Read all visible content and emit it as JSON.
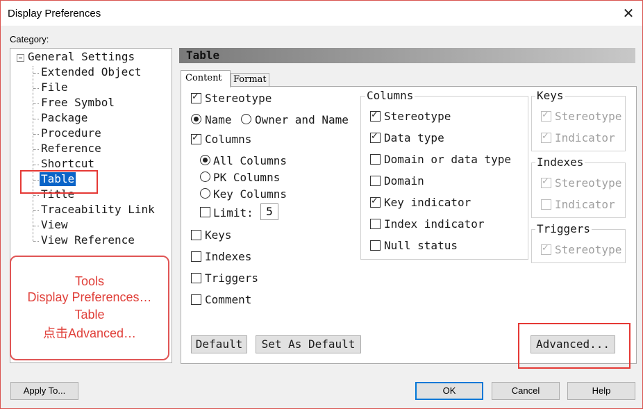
{
  "window": {
    "title": "Display Preferences",
    "close_glyph": "✕"
  },
  "category": {
    "label": "Category:"
  },
  "tree": {
    "root": "General Settings",
    "items": [
      "Extended Object",
      "File",
      "Free Symbol",
      "Package",
      "Procedure",
      "Reference",
      "Shortcut",
      "Table",
      "Title",
      "Traceability Link",
      "View",
      "View Reference"
    ],
    "selected": "Table"
  },
  "annotation": {
    "lines": [
      "Tools",
      "Display Preferences…",
      "Table",
      "点击Advanced…"
    ]
  },
  "panel": {
    "header": "Table",
    "tabs": [
      "Content",
      "Format"
    ],
    "active_tab": "Content"
  },
  "left_options": {
    "stereotype": {
      "label": "Stereotype",
      "checked": true
    },
    "name_radio": {
      "label": "Name",
      "checked": true
    },
    "owner_radio": {
      "label": "Owner and Name",
      "checked": false
    },
    "columns": {
      "label": "Columns",
      "checked": true
    },
    "all_columns": {
      "label": "All Columns",
      "checked": true
    },
    "pk_columns": {
      "label": "PK Columns",
      "checked": false
    },
    "key_columns": {
      "label": "Key Columns",
      "checked": false
    },
    "limit": {
      "label": "Limit:",
      "checked": false,
      "value": "5"
    },
    "keys": {
      "label": "Keys",
      "checked": false
    },
    "indexes": {
      "label": "Indexes",
      "checked": false
    },
    "triggers": {
      "label": "Triggers",
      "checked": false
    },
    "comment": {
      "label": "Comment",
      "checked": false
    }
  },
  "columns_group": {
    "title": "Columns",
    "items": [
      {
        "label": "Stereotype",
        "checked": true
      },
      {
        "label": "Data type",
        "checked": true
      },
      {
        "label": "Domain or data type",
        "checked": false
      },
      {
        "label": "Domain",
        "checked": false
      },
      {
        "label": "Key indicator",
        "checked": true
      },
      {
        "label": "Index indicator",
        "checked": false
      },
      {
        "label": "Null status",
        "checked": false
      }
    ]
  },
  "keys_group": {
    "title": "Keys",
    "items": [
      {
        "label": "Stereotype",
        "checked": true
      },
      {
        "label": "Indicator",
        "checked": true
      }
    ]
  },
  "indexes_group": {
    "title": "Indexes",
    "items": [
      {
        "label": "Stereotype",
        "checked": true
      },
      {
        "label": "Indicator",
        "checked": false
      }
    ]
  },
  "triggers_group": {
    "title": "Triggers",
    "items": [
      {
        "label": "Stereotype",
        "checked": true
      }
    ]
  },
  "panel_buttons": {
    "default": "Default",
    "set_as_default": "Set As Default",
    "advanced": "Advanced..."
  },
  "footer": {
    "apply_to": "Apply To...",
    "ok": "OK",
    "cancel": "Cancel",
    "help": "Help"
  },
  "colors": {
    "selection": "#0a64c8",
    "annotation": "#e0403a",
    "highlight_border": "#e53935"
  }
}
